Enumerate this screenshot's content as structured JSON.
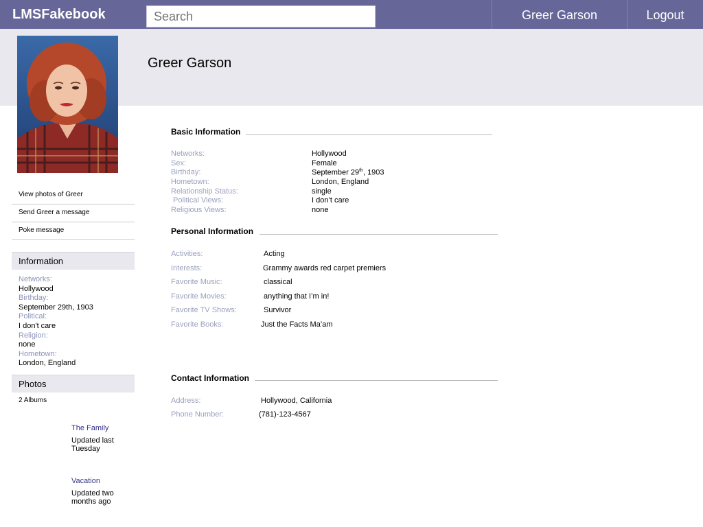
{
  "nav": {
    "brand": "LMSFakebook",
    "search_placeholder": "Search",
    "user_name": "Greer Garson",
    "logout": "Logout"
  },
  "profile": {
    "name": "Greer Garson"
  },
  "actions": [
    "View photos of Greer",
    "Send Greer a message",
    "Poke message"
  ],
  "sidebar": {
    "info_title": "Information",
    "info": {
      "networks_label": "Networks:",
      "networks": "Hollywood",
      "birthday_label": "Birthday:",
      "birthday": "September 29th, 1903",
      "political_label": "Political:",
      "political": "I don't care",
      "religion_label": "Religion:",
      "religion": "none",
      "hometown_label": "Hometown:",
      "hometown": "London, England"
    },
    "photos_title": "Photos",
    "albums_count": "2 Albums",
    "albums": [
      {
        "title": "The Family",
        "updated": "Updated last Tuesday"
      },
      {
        "title": "Vacation",
        "updated": "Updated two months ago"
      }
    ]
  },
  "basic": {
    "title": "Basic Information",
    "networks_label": "Networks:",
    "networks": "Hollywood",
    "sex_label": "Sex:",
    "sex": "Female",
    "birthday_label": "Birthday:",
    "birthday_month_day": "September 29",
    "birthday_suffix": "th",
    "birthday_year": ", 1903",
    "hometown_label": "Hometown:",
    "hometown": "London, England",
    "relationship_label": "Relationship Status:",
    "relationship": "single",
    "political_label": "Political Views:",
    "political": "I don’t care",
    "religious_label": "Religious Views:",
    "religious": "none"
  },
  "personal": {
    "title": "Personal Information",
    "activities_label": "Activities:",
    "activities": "Acting",
    "interests_label": "Interests:",
    "interests": "Grammy awards red carpet premiers",
    "music_label": "Favorite Music:",
    "music": "classical",
    "movies_label": "Favorite Movies:",
    "movies": "anything that I’m in!",
    "tv_label": "Favorite TV Shows:",
    "tv": "Survivor",
    "books_label": "Favorite Books:",
    "books": "Just the Facts Ma’am"
  },
  "contact": {
    "title": "Contact Information",
    "address_label": "Address:",
    "address": "Hollywood, California",
    "phone_label": "Phone Number:",
    "phone": "(781)-123-4567"
  }
}
